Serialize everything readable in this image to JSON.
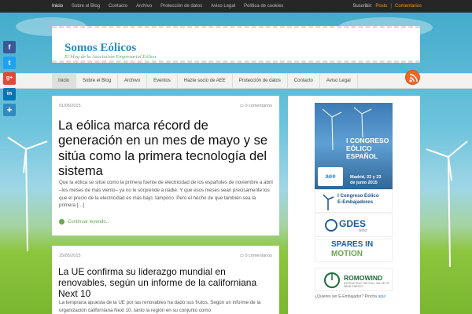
{
  "topbar": {
    "nav": [
      {
        "label": "Inicio",
        "active": true
      },
      {
        "label": "Sobre el Blog"
      },
      {
        "label": "Contacto"
      },
      {
        "label": "Archivo"
      },
      {
        "label": "Protección de datos"
      },
      {
        "label": "Aviso Legal"
      },
      {
        "label": "Política de cookies"
      }
    ],
    "subscribe_label": "Suscribir:",
    "posts_link": "Posts",
    "separator": "|",
    "comments_link": "Comentarios"
  },
  "header": {
    "site_title": "Somos Eólicos",
    "tagline": "El blog de la Asociación Empresarial Eólica"
  },
  "mainnav": [
    {
      "label": "Inicio",
      "active": true
    },
    {
      "label": "Sobre el Blog"
    },
    {
      "label": "Archivo"
    },
    {
      "label": "Eventos"
    },
    {
      "label": "Hazte socio de AEE"
    },
    {
      "label": "Protección de datos"
    },
    {
      "label": "Contacto"
    },
    {
      "label": "Aviso Legal"
    }
  ],
  "share_icons": [
    {
      "name": "facebook-icon",
      "glyph": "f",
      "color": "#3b5998"
    },
    {
      "name": "twitter-icon",
      "glyph": "t",
      "color": "#1da1f2"
    },
    {
      "name": "google-plus-icon",
      "glyph": "g+",
      "color": "#dd4b39"
    },
    {
      "name": "linkedin-icon",
      "glyph": "in",
      "color": "#0077b5"
    },
    {
      "name": "share-icon",
      "glyph": "+",
      "color": "#2f8bbf"
    }
  ],
  "posts": [
    {
      "date": "01/06/2015",
      "comments": "0 comentarios",
      "title": "La eólica marca récord de generación en un mes de mayo y se sitúa como la primera tecnología del sistema",
      "excerpt": "Que la eólica se sitúe como la primera fuente de electricidad de los españoles de noviembre a abril –los meses de más viento– ya no le sorprende a nadie. Y que esos meses sean precisamente los que el precio de la electricidad es más bajo, tampoco. Pero el hecho de que también sea la primera […]",
      "more": "Continuar leyendo..."
    },
    {
      "date": "15/05/2015",
      "comments": "0 comentarios",
      "title": "La UE confirma su liderazgo mundial en renovables, según un informe de la californiana Next 10",
      "excerpt": "La temprana apuesta de la UE por las renovables ha dado sus frutos. Según un informe de la organización californiana Next 10, tanto la región en su conjunto como"
    }
  ],
  "sidebar": {
    "banner": {
      "title_lines": [
        "I CONGRESO",
        "EÓLICO",
        "ESPAÑOL"
      ],
      "date_lines": [
        "Madrid, 22 y 23",
        "de junio 2015"
      ],
      "logo": "aee"
    },
    "logos": [
      {
        "title": "I Congreso Eólico",
        "subtitle": "E-Embajadores"
      },
      {
        "title": "GDES",
        "subtitle": "wind"
      },
      {
        "title": "SPARES IN",
        "subtitle": "MOTION"
      },
      {
        "title": "ROMOWIND",
        "subtitle": "EXTRACTING THE FULL VALUE OF WIND ENERGY"
      }
    ],
    "ambassador_text": "¿Quieres ser E-Embajador? Pincha",
    "ambassador_link": "aquí"
  },
  "colors": {
    "accent": "#2f8bbf",
    "green": "#6aa84f",
    "orange": "#f7941d",
    "rss": "#f26522"
  }
}
